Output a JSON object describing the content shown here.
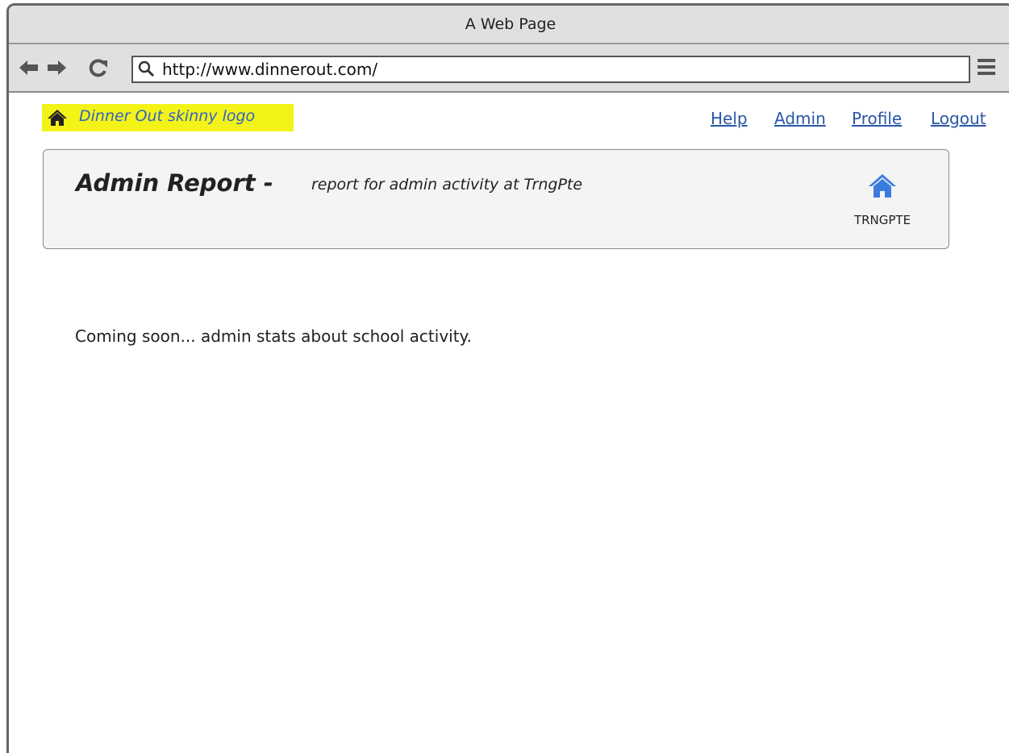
{
  "window": {
    "title": "A Web Page"
  },
  "browser": {
    "url": "http://www.dinnerout.com/",
    "icons": [
      "back-arrow-icon",
      "forward-arrow-icon",
      "reload-icon",
      "search-icon",
      "hamburger-menu-icon"
    ]
  },
  "header": {
    "logo_text": "Dinner Out skinny logo",
    "links": [
      "Help",
      "Admin",
      "Profile",
      "Logout"
    ]
  },
  "panel": {
    "title": "Admin Report -",
    "subtitle": "report for admin activity at TrngPte",
    "home_label": "TRNGPTE"
  },
  "main": {
    "message": "Coming soon... admin stats about school activity."
  },
  "colors": {
    "link": "#2a56a8",
    "logo_highlight": "#f3f318",
    "panel_home_icon": "#3b7dde"
  }
}
